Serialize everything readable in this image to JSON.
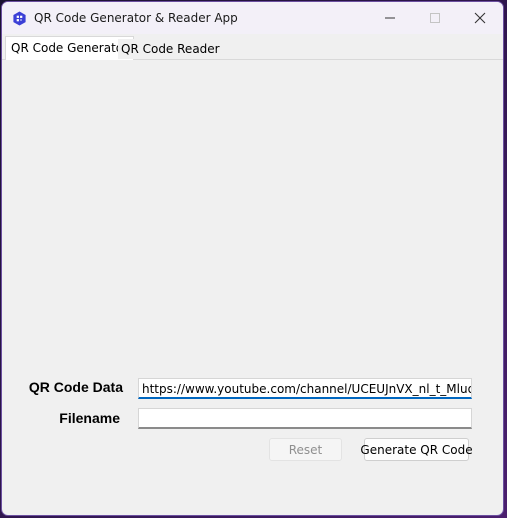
{
  "window": {
    "title": "QR Code Generator & Reader App",
    "icon": "qr-app-icon",
    "controls": [
      "minimize-icon",
      "maximize-icon",
      "close-icon"
    ]
  },
  "tabs": [
    {
      "label": "QR Code Generator",
      "active": true
    },
    {
      "label": "QR Code Reader",
      "active": false
    }
  ],
  "form": {
    "qr_data_label": "QR Code Data",
    "qr_data_value": "https://www.youtube.com/channel/UCEUJnVX_nl_t_MluotqGd",
    "filename_label": "Filename",
    "filename_value": ""
  },
  "buttons": {
    "reset_label": "Reset",
    "generate_label": "Generate QR Code"
  },
  "colors": {
    "accent": "#0067c0",
    "window_bg": "#f0f0f0",
    "app_icon": "#3b3fd6"
  }
}
